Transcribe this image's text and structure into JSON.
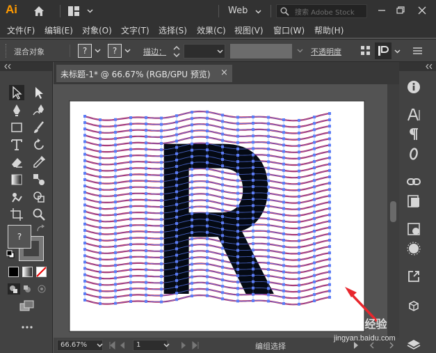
{
  "app": {
    "logo_text": "Ai",
    "workspace": "Web",
    "search_placeholder": "搜索 Adobe Stock",
    "logo_color": "#ff9a00"
  },
  "menu": [
    "文件(F)",
    "编辑(E)",
    "对象(O)",
    "文字(T)",
    "选择(S)",
    "效果(C)",
    "视图(V)",
    "窗口(W)",
    "帮助(H)"
  ],
  "control": {
    "selection_label": "混合对象",
    "fill_symbol": "?",
    "stroke_symbol": "?",
    "stroke_label": "描边：",
    "opacity_label": "不透明度"
  },
  "document": {
    "tab_title": "未标题-1* @ 66.67% (RGB/GPU 预览)",
    "close_symbol": "×"
  },
  "status": {
    "zoom": "66.67%",
    "page": "1",
    "tool_status": "编组选择"
  },
  "tools": {
    "fill_stroke_symbol": "?"
  },
  "artwork": {
    "letter": "R",
    "wave_color": "#c4234a",
    "anchor_color": "#5b7cf5",
    "letter_color": "#050a14"
  },
  "watermark": {
    "brand": "Baidu经验",
    "url": "jingyan.baidu.com"
  },
  "annotation": {
    "arrow_color": "#e8272d"
  }
}
